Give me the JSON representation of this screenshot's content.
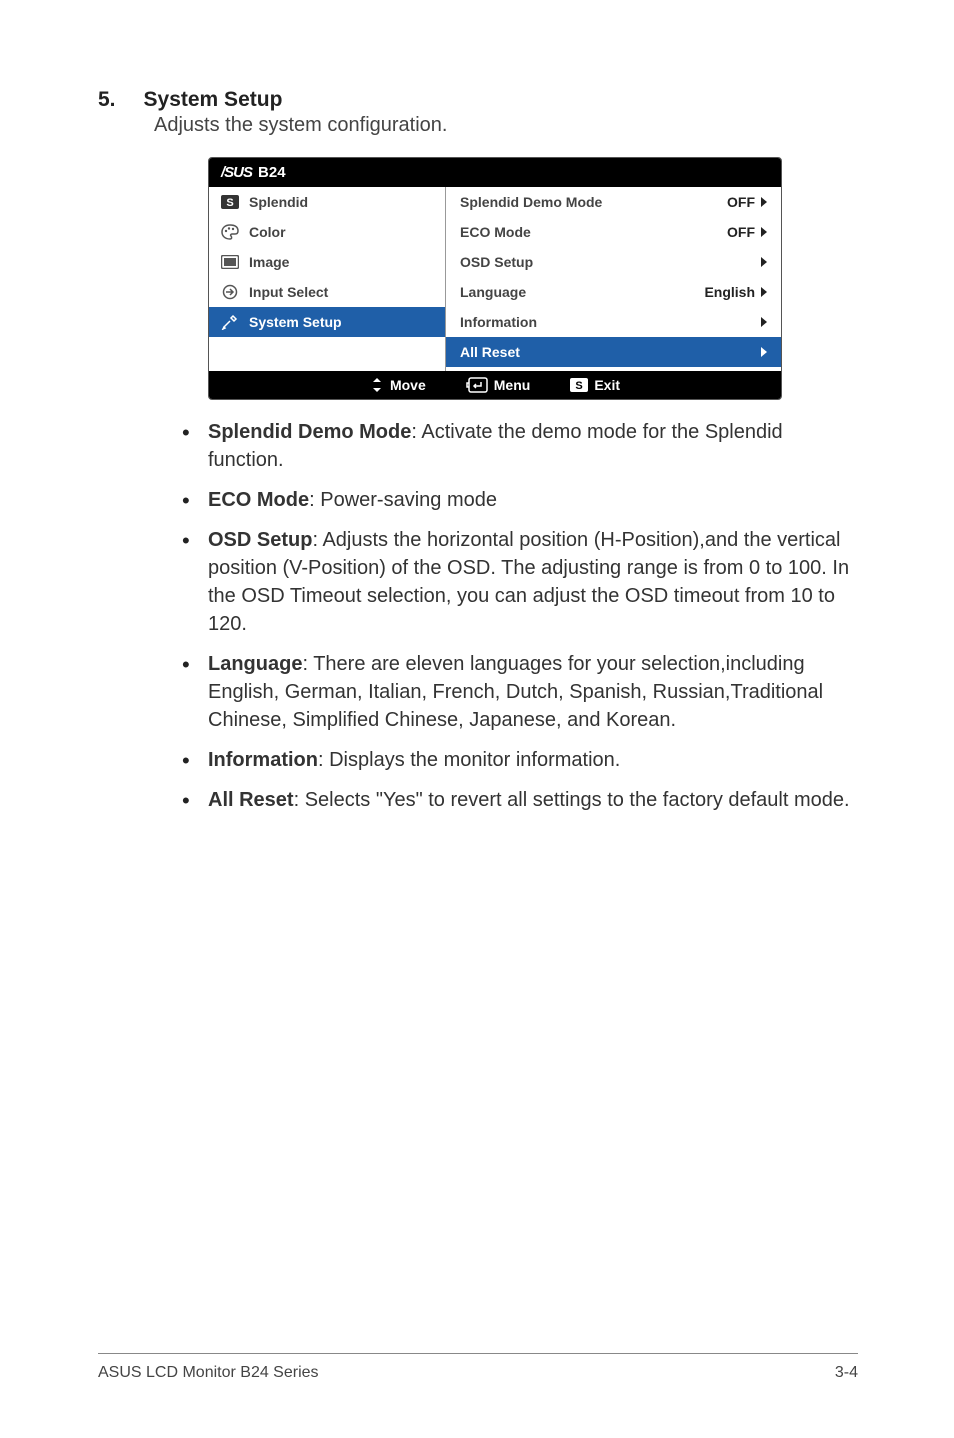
{
  "section": {
    "number": "5.",
    "title": "System Setup",
    "subtitle": "Adjusts the system configuration."
  },
  "osd": {
    "logo": "/SUS",
    "model": "B24",
    "left": [
      {
        "icon": "S",
        "label": "Splendid",
        "selected": false
      },
      {
        "icon": "color",
        "label": "Color",
        "selected": false
      },
      {
        "icon": "image",
        "label": "Image",
        "selected": false
      },
      {
        "icon": "input",
        "label": "Input Select",
        "selected": false
      },
      {
        "icon": "setup",
        "label": "System Setup",
        "selected": true
      }
    ],
    "right": [
      {
        "label": "Splendid Demo Mode",
        "value": "OFF",
        "selected": false
      },
      {
        "label": "ECO Mode",
        "value": "OFF",
        "selected": false
      },
      {
        "label": "OSD Setup",
        "value": "",
        "selected": false
      },
      {
        "label": "Language",
        "value": "English",
        "selected": false
      },
      {
        "label": "Information",
        "value": "",
        "selected": false
      },
      {
        "label": "All Reset",
        "value": "",
        "selected": true
      }
    ],
    "footer": {
      "move": "Move",
      "menu": "Menu",
      "exit": "Exit",
      "exitKey": "S"
    }
  },
  "bullets": [
    {
      "lead": "Splendid Demo Mode",
      "text": ": Activate the demo mode for the Splendid function."
    },
    {
      "lead": "ECO Mode",
      "text": ": Power-saving mode"
    },
    {
      "lead": "OSD Setup",
      "text": ": Adjusts the horizontal position (H-Position),and the vertical position (V-Position) of the OSD. The adjusting range is from 0 to 100. In the OSD Timeout selection, you can adjust the OSD timeout from 10 to 120."
    },
    {
      "lead": "Language",
      "text": ": There are eleven languages for your selection,including English, German, Italian, French, Dutch, Spanish, Russian,Traditional Chinese, Simplified Chinese, Japanese, and Korean."
    },
    {
      "lead": "Information",
      "text": ": Displays the monitor information."
    },
    {
      "lead": "All Reset",
      "text": ": Selects \"Yes\" to revert all settings to the factory default mode."
    }
  ],
  "footer": {
    "left": "ASUS LCD Monitor B24 Series",
    "right": "3-4"
  }
}
